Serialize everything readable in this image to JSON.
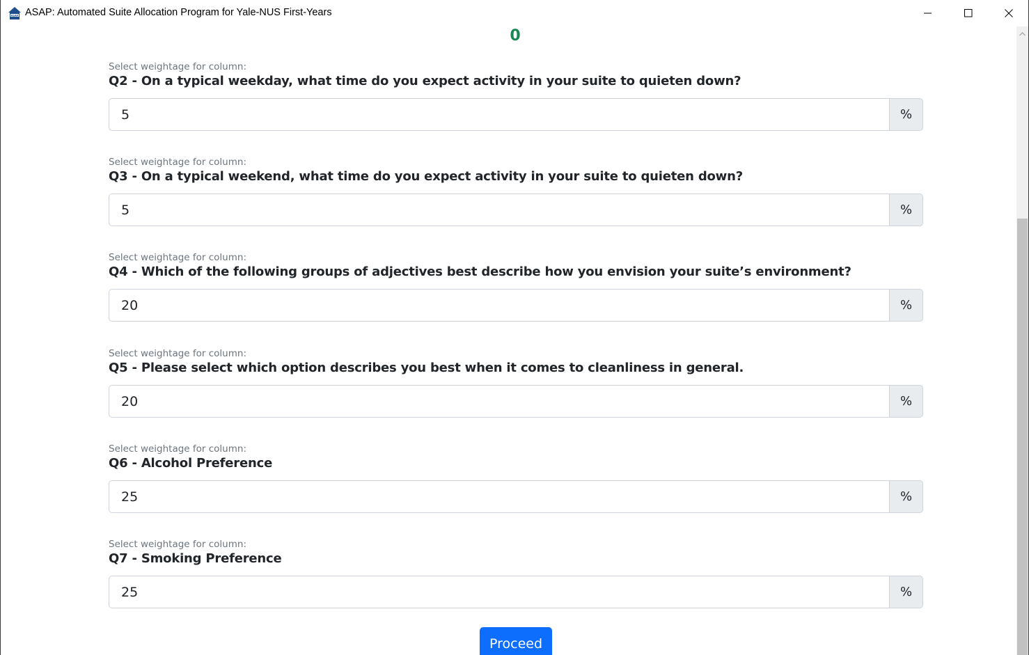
{
  "window": {
    "title": "ASAP: Automated Suite Allocation Program for Yale-NUS First-Years",
    "icon": "house-icon",
    "controls": [
      "minimize-icon",
      "maximize-icon",
      "close-icon"
    ]
  },
  "counter": {
    "value": "0",
    "color": "#198754"
  },
  "fields": [
    {
      "hint": "Select weightage for column:",
      "question": "Q2 - On a typical weekday, what time do you expect activity in your suite to quieten down?",
      "value": "5",
      "unit": "%"
    },
    {
      "hint": "Select weightage for column:",
      "question": "Q3 - On a typical weekend, what time do you expect activity in your suite to quieten down?",
      "value": "5",
      "unit": "%"
    },
    {
      "hint": "Select weightage for column:",
      "question": "Q4 - Which of the following groups of adjectives best describe how you envision your suite’s environment?",
      "value": "20",
      "unit": "%"
    },
    {
      "hint": "Select weightage for column:",
      "question": "Q5 - Please select which option describes you best when it comes to cleanliness in general.",
      "value": "20",
      "unit": "%"
    },
    {
      "hint": "Select weightage for column:",
      "question": "Q6 - Alcohol Preference",
      "value": "25",
      "unit": "%"
    },
    {
      "hint": "Select weightage for column:",
      "question": "Q7 - Smoking Preference",
      "value": "25",
      "unit": "%"
    }
  ],
  "actions": {
    "proceed_label": "Proceed",
    "accent": "#0d6efd"
  }
}
